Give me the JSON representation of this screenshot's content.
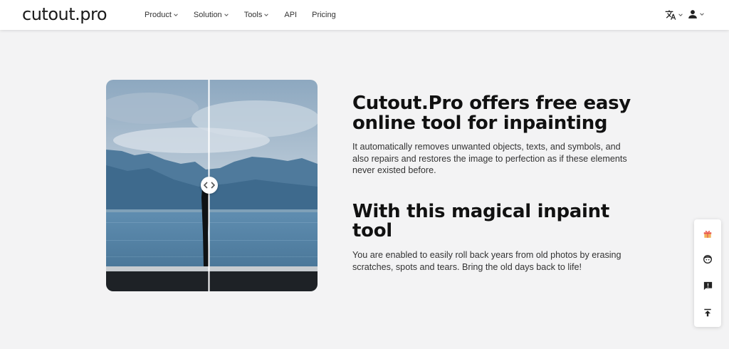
{
  "header": {
    "logo": "cutout.pro",
    "nav": [
      {
        "label": "Product",
        "has_dropdown": true
      },
      {
        "label": "Solution",
        "has_dropdown": true
      },
      {
        "label": "Tools",
        "has_dropdown": true
      },
      {
        "label": "API",
        "has_dropdown": false
      },
      {
        "label": "Pricing",
        "has_dropdown": false
      }
    ],
    "right_icons": [
      "translate-icon",
      "user-icon"
    ]
  },
  "main": {
    "heading1": "Cutout.Pro offers free easy online tool for inpainting",
    "paragraph1": "It automatically removes unwanted objects, texts, and symbols, and also repairs and restores the image to perfection as if these elements never existed before.",
    "heading2": "With this magical inpaint tool",
    "paragraph2": "You are enabled to easily roll back years from old photos by erasing scratches, spots and tears. Bring the old days back to life!",
    "comparison_slider_icon": "compare-arrows-icon"
  },
  "floating_toolbar": [
    "gift-icon",
    "support-face-icon",
    "feedback-icon",
    "back-to-top-icon"
  ],
  "colors": {
    "background": "#f3f3f4",
    "header_bg": "#ffffff",
    "gift_accent": "#e9574b",
    "text_dark": "#111111"
  }
}
